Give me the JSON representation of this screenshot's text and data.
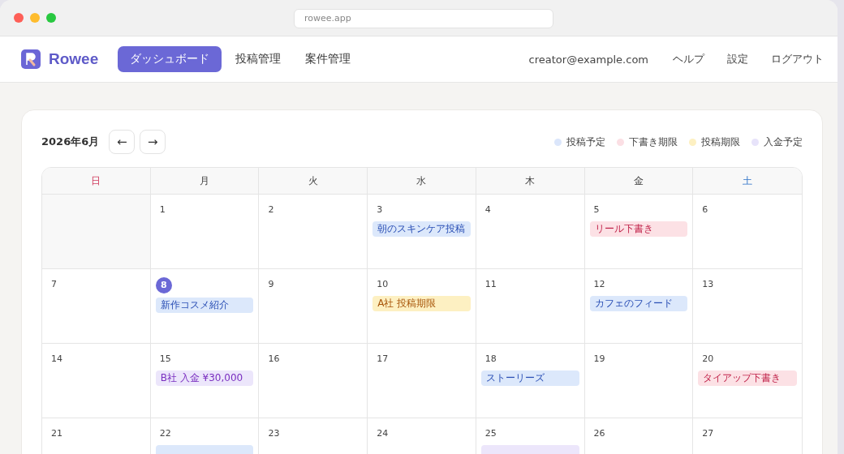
{
  "browser": {
    "address": "rowee.app"
  },
  "nav": {
    "brand": "Rowee",
    "items": [
      {
        "label": "ダッシュボード",
        "selected": true
      },
      {
        "label": "投稿管理",
        "selected": false
      },
      {
        "label": "案件管理",
        "selected": false
      }
    ],
    "account": "creator@example.com",
    "links": [
      "ヘルプ",
      "設定",
      "ログアウト"
    ]
  },
  "calendar": {
    "month": "2026年6月",
    "prev": "←",
    "next": "→",
    "legend": [
      {
        "label": "投稿予定",
        "color": "#dbe6fb"
      },
      {
        "label": "下書き期限",
        "color": "#fbdfe4"
      },
      {
        "label": "投稿期限",
        "color": "#fdf0c2"
      },
      {
        "label": "入金予定",
        "color": "#e7e3fa"
      }
    ],
    "weekdays": [
      {
        "label": "日",
        "kind": "sunday"
      },
      {
        "label": "月",
        "kind": "weekday"
      },
      {
        "label": "火",
        "kind": "weekday"
      },
      {
        "label": "水",
        "kind": "weekday"
      },
      {
        "label": "木",
        "kind": "weekday"
      },
      {
        "label": "金",
        "kind": "weekday"
      },
      {
        "label": "土",
        "kind": "saturday"
      }
    ],
    "weeks": [
      [
        {
          "kind": "empty"
        },
        {
          "kind": "day",
          "day": "1"
        },
        {
          "kind": "day",
          "day": "2"
        },
        {
          "kind": "day",
          "day": "3",
          "events": [
            {
              "label": "朝のスキンケア投稿",
              "kind": "post"
            }
          ]
        },
        {
          "kind": "day",
          "day": "4"
        },
        {
          "kind": "day",
          "day": "5",
          "events": [
            {
              "label": "リール下書き",
              "kind": "draft"
            }
          ]
        },
        {
          "kind": "day",
          "day": "6"
        }
      ],
      [
        {
          "kind": "day",
          "day": "7"
        },
        {
          "kind": "day",
          "day": "8",
          "today": true,
          "events": [
            {
              "label": "新作コスメ紹介",
              "kind": "post"
            }
          ]
        },
        {
          "kind": "day",
          "day": "9"
        },
        {
          "kind": "day",
          "day": "10",
          "events": [
            {
              "label": "A社 投稿期限",
              "kind": "deadline"
            }
          ]
        },
        {
          "kind": "day",
          "day": "11"
        },
        {
          "kind": "day",
          "day": "12",
          "events": [
            {
              "label": "カフェのフィード",
              "kind": "post"
            }
          ]
        },
        {
          "kind": "day",
          "day": "13"
        }
      ],
      [
        {
          "kind": "day",
          "day": "14"
        },
        {
          "kind": "day",
          "day": "15",
          "events": [
            {
              "label": "B社 入金 ¥30,000",
              "kind": "payment"
            }
          ]
        },
        {
          "kind": "day",
          "day": "16"
        },
        {
          "kind": "day",
          "day": "17"
        },
        {
          "kind": "day",
          "day": "18",
          "events": [
            {
              "label": "ストーリーズ",
              "kind": "post"
            }
          ]
        },
        {
          "kind": "day",
          "day": "19"
        },
        {
          "kind": "day",
          "day": "20",
          "events": [
            {
              "label": "タイアップ下書き",
              "kind": "draft"
            }
          ]
        }
      ],
      [
        {
          "kind": "day",
          "day": "21"
        },
        {
          "kind": "day",
          "day": "22",
          "events": [
            {
              "kind": "post"
            }
          ]
        },
        {
          "kind": "day",
          "day": "23"
        },
        {
          "kind": "day",
          "day": "24"
        },
        {
          "kind": "day",
          "day": "25",
          "events": [
            {
              "kind": "payment"
            }
          ]
        },
        {
          "kind": "day",
          "day": "26"
        },
        {
          "kind": "day",
          "day": "27"
        }
      ]
    ]
  }
}
